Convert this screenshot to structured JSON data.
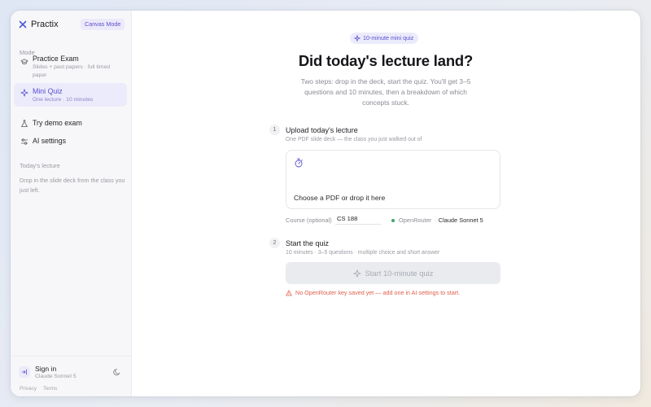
{
  "brand": {
    "name": "Practix",
    "mode_badge": "Canvas Mode"
  },
  "sidebar": {
    "mode_label": "Mode",
    "items": [
      {
        "title": "Practice Exam",
        "subtitle_line1": "Slides + past papers · full timed",
        "subtitle_line2": "paper",
        "icon": "graduation-cap-icon"
      },
      {
        "title": "Mini Quiz",
        "subtitle": "One lecture · 10 minutes",
        "icon": "sparkle-icon",
        "active": true
      },
      {
        "title": "Try demo exam",
        "icon": "flask-icon"
      },
      {
        "title": "AI settings",
        "icon": "sliders-icon"
      }
    ],
    "today_label": "Today's lecture",
    "today_note": "Drop in the slide deck from the class you just left.",
    "footer": {
      "signin_title": "Sign in",
      "signin_sub": "Claude Sonnet 5",
      "privacy": "Privacy",
      "terms": "Terms"
    }
  },
  "main": {
    "pill": "10-minute mini quiz",
    "headline": "Did today's lecture land?",
    "subtitle": "Two steps: drop in the deck, start the quiz. You'll get 3–5 questions and 10 minutes, then a breakdown of which concepts stuck.",
    "step1": {
      "number": "1",
      "title": "Upload today's lecture",
      "subtitle": "One PDF slide deck — the class you just walked out of",
      "dropzone_text": "Choose a PDF or drop it here",
      "course_label": "Course (optional)",
      "course_value": "CS 188",
      "provider": "OpenRouter",
      "separator": "·",
      "model": "Claude Sonnet 5"
    },
    "step2": {
      "number": "2",
      "title": "Start the quiz",
      "subtitle": "10 minutes · 3–5 questions · multiple choice and short answer",
      "button_label": "Start 10-minute quiz",
      "warning": "No OpenRouter key saved yet — add one in AI settings to start."
    }
  },
  "colors": {
    "accent": "#5a4fd0",
    "accent_bg": "#ecebfb",
    "warning": "#e0604e",
    "status_ok": "#3aa76d"
  }
}
